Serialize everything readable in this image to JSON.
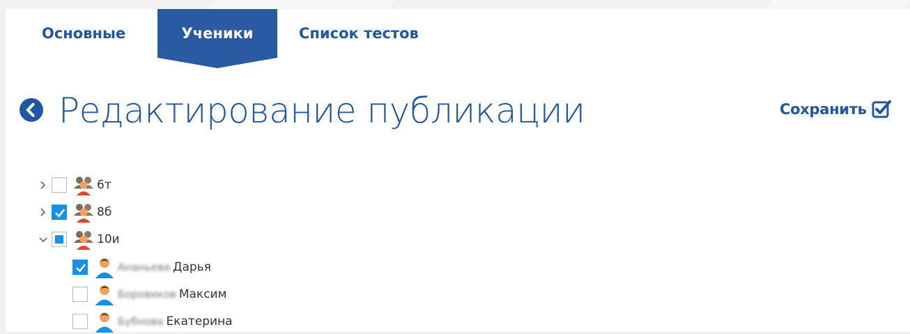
{
  "tabs": [
    {
      "label": "Основные",
      "active": false
    },
    {
      "label": "Ученики",
      "active": true
    },
    {
      "label": "Список тестов",
      "active": false
    }
  ],
  "page": {
    "title": "Редактирование публикации",
    "back_icon": "back-circle-icon",
    "save_label": "Сохранить",
    "save_icon": "checkbox-checked-icon"
  },
  "tree": {
    "groups": [
      {
        "label": "6т",
        "expanded": false,
        "check": "unchecked",
        "icon": "group-icon"
      },
      {
        "label": "8б",
        "expanded": false,
        "check": "checked",
        "icon": "group-icon"
      },
      {
        "label": "10и",
        "expanded": true,
        "check": "partial",
        "icon": "group-icon"
      }
    ],
    "students": [
      {
        "surname_blurred": "Ананьева",
        "name": "Дарья",
        "check": "checked",
        "icon": "user-icon"
      },
      {
        "surname_blurred": "Боровиков",
        "name": "Максим",
        "check": "unchecked",
        "icon": "user-icon"
      },
      {
        "surname_blurred": "Бубнова",
        "name": "Екатерина",
        "check": "unchecked",
        "icon": "user-icon"
      }
    ]
  },
  "colors": {
    "accent": "#1f57a3",
    "tab_active_bg": "#2a5aa2",
    "checkbox_blue": "#1592e6"
  }
}
